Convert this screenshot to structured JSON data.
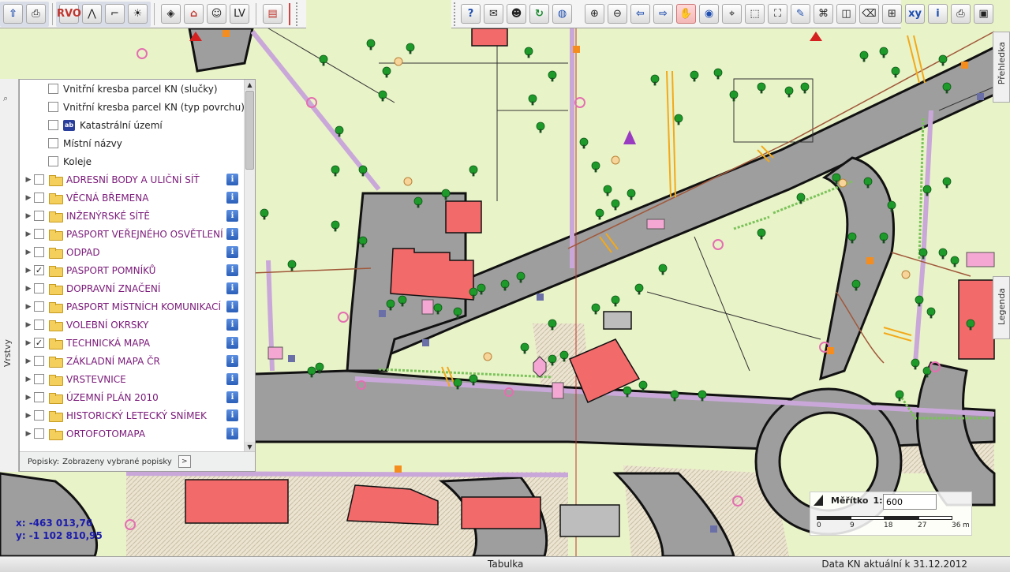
{
  "toolbar_left": {
    "buttons": [
      {
        "name": "layers-manager-button",
        "glyph": "⇧"
      },
      {
        "name": "print-button",
        "glyph": "⎙"
      },
      {
        "name": "rvo-tool-button",
        "glyph": "RVO"
      },
      {
        "name": "line-tool-button",
        "glyph": "⋀"
      },
      {
        "name": "parcel-info-button",
        "glyph": "⌐"
      },
      {
        "name": "bulb-tool-button",
        "glyph": "☀"
      },
      {
        "name": "measure-tool-button",
        "glyph": "◈"
      },
      {
        "name": "building-tool-button",
        "glyph": "⌂"
      },
      {
        "name": "person-tool-button",
        "glyph": "☺"
      },
      {
        "name": "lv-tool-button",
        "glyph": "LV"
      },
      {
        "name": "report-button",
        "glyph": "▤"
      }
    ]
  },
  "toolbar_right": {
    "buttons": [
      {
        "name": "help-button",
        "glyph": "?"
      },
      {
        "name": "mail-button",
        "glyph": "✉"
      },
      {
        "name": "user-button",
        "glyph": "☻"
      },
      {
        "name": "refresh-button",
        "glyph": "↻"
      },
      {
        "name": "globe-button",
        "glyph": "◍"
      },
      {
        "name": "zoom-in-button",
        "glyph": "⊕"
      },
      {
        "name": "zoom-out-button",
        "glyph": "⊖"
      },
      {
        "name": "back-button",
        "glyph": "⇦"
      },
      {
        "name": "forward-button",
        "glyph": "⇨"
      },
      {
        "name": "pan-button",
        "glyph": "✋"
      },
      {
        "name": "full-extent-button",
        "glyph": "◉"
      },
      {
        "name": "zoom-layer-button",
        "glyph": "⌖"
      },
      {
        "name": "zoom-window-button",
        "glyph": "⬚"
      },
      {
        "name": "select-button",
        "glyph": "⛶"
      },
      {
        "name": "draw-button",
        "glyph": "✎"
      },
      {
        "name": "identify-button",
        "glyph": "⌘"
      },
      {
        "name": "overlay-button",
        "glyph": "◫"
      },
      {
        "name": "eraser-button",
        "glyph": "⌫"
      },
      {
        "name": "stamp-button",
        "glyph": "⊞"
      },
      {
        "name": "xy-button",
        "glyph": "xy"
      },
      {
        "name": "info-button",
        "glyph": "i"
      },
      {
        "name": "print-map-button",
        "glyph": "⎙"
      },
      {
        "name": "save-button",
        "glyph": "▣"
      }
    ]
  },
  "left_dock": {
    "label": "Vrstvy"
  },
  "layers": {
    "sublayers": [
      {
        "label": "Vnitřní kresba parcel KN (slučky)",
        "checked": false,
        "icon": "none"
      },
      {
        "label": "Vnitřní kresba parcel KN (typ povrchu)",
        "checked": false,
        "icon": "none"
      },
      {
        "label": "Katastrální území",
        "checked": false,
        "icon": "ab"
      },
      {
        "label": "Místní názvy",
        "checked": false,
        "icon": "none"
      },
      {
        "label": "Koleje",
        "checked": false,
        "icon": "none"
      }
    ],
    "groups": [
      {
        "label": "ADRESNÍ BODY A ULIČNÍ SÍŤ",
        "checked": false
      },
      {
        "label": "VĚCNÁ BŘEMENA",
        "checked": false
      },
      {
        "label": "INŽENÝRSKÉ SÍTĚ",
        "checked": false
      },
      {
        "label": "PASPORT VEŘEJNÉHO OSVĚTLENÍ",
        "checked": false
      },
      {
        "label": "ODPAD",
        "checked": false
      },
      {
        "label": "PASPORT POMNÍKŮ",
        "checked": true
      },
      {
        "label": "DOPRAVNÍ ZNAČENÍ",
        "checked": false
      },
      {
        "label": "PASPORT MÍSTNÍCH KOMUNIKACÍ",
        "checked": false
      },
      {
        "label": "VOLEBNÍ OKRSKY",
        "checked": false
      },
      {
        "label": "TECHNICKÁ MAPA",
        "checked": true
      },
      {
        "label": "ZÁKLADNÍ MAPA ČR",
        "checked": false
      },
      {
        "label": "VRSTEVNICE",
        "checked": false
      },
      {
        "label": "ÚZEMNÍ PLÁN 2010",
        "checked": false
      },
      {
        "label": "HISTORICKÝ LETECKÝ SNÍMEK",
        "checked": false
      },
      {
        "label": "ORTOFOTOMAPA",
        "checked": false
      }
    ],
    "info_glyph": "i",
    "footer_label": "Popisky:",
    "footer_value": "Zobrazeny vybrané popisky",
    "footer_button": ">"
  },
  "side_tabs": {
    "overview": "Přehledka",
    "legend": "Legenda"
  },
  "coordinates": {
    "x": "x:  -463 013,76",
    "y": "y:  -1 102 810,95"
  },
  "scale": {
    "label": "Měřítko",
    "prefix": "1:",
    "value": "600",
    "ticks": [
      "0",
      "9",
      "18",
      "27",
      "36"
    ],
    "unit": "m"
  },
  "statusbar": {
    "table_label": "Tabulka",
    "data_info": "Data KN aktuální k 31.12.2012"
  },
  "colors": {
    "map_background": "#e9f3c8",
    "road": "#9e9e9e",
    "building": "#f26a6a",
    "tree": "#1e9a2a",
    "boundary": "#c9a8d9",
    "group_text": "#7a1a79",
    "coord_text": "#1c1cae"
  }
}
